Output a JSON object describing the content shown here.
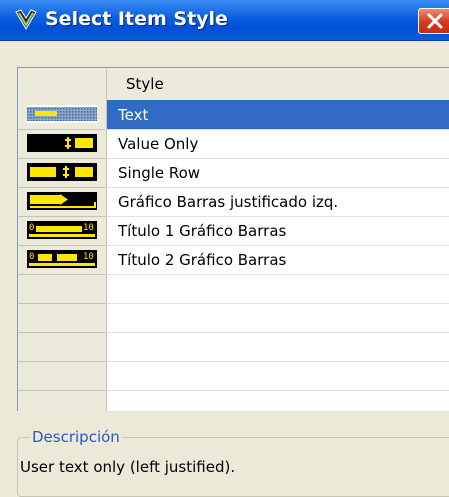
{
  "window": {
    "title": "Select Item Style"
  },
  "grid": {
    "header": {
      "style_label": "Style"
    },
    "rows": [
      {
        "label": "Text",
        "icon": "text-style-icon",
        "selected": true
      },
      {
        "label": "Value Only",
        "icon": "value-only-style-icon",
        "selected": false
      },
      {
        "label": "Single Row",
        "icon": "single-row-style-icon",
        "selected": false
      },
      {
        "label": "Gráfico Barras justificado izq.",
        "icon": "bar-chart-left-justified-icon",
        "selected": false
      },
      {
        "label": "Título 1 Gráfico Barras",
        "icon": "title-1-bar-chart-icon",
        "selected": false
      },
      {
        "label": "Título 2 Gráfico Barras",
        "icon": "title-2-bar-chart-icon",
        "selected": false
      }
    ]
  },
  "description": {
    "legend": "Descripción",
    "text": "User text only (left justified)."
  },
  "colors": {
    "titlebar": "#0a5fe0",
    "selection": "#316ac5",
    "style_icon_yellow": "#ffe600",
    "legend_blue": "#2a58c4"
  }
}
